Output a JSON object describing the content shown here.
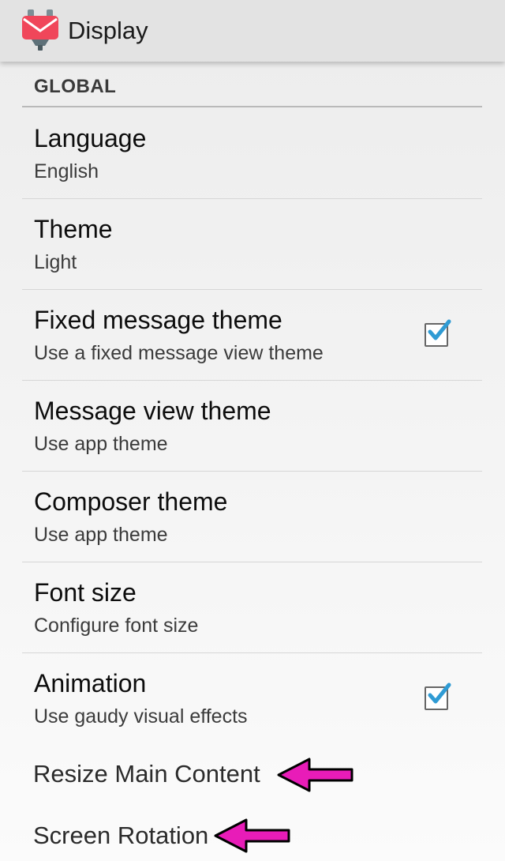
{
  "appbar": {
    "title": "Display",
    "icon": "envelope-pin-icon"
  },
  "section": {
    "header": "GLOBAL"
  },
  "prefs": [
    {
      "title": "Language",
      "summary": "English"
    },
    {
      "title": "Theme",
      "summary": "Light"
    },
    {
      "title": "Fixed message theme",
      "summary": "Use a fixed message view theme",
      "checked": true
    },
    {
      "title": "Message view theme",
      "summary": "Use app theme"
    },
    {
      "title": "Composer theme",
      "summary": "Use app theme"
    },
    {
      "title": "Font size",
      "summary": "Configure font size"
    },
    {
      "title": "Animation",
      "summary": "Use gaudy visual effects",
      "checked": true
    }
  ],
  "extras": [
    {
      "label": "Resize Main Content"
    },
    {
      "label": "Screen Rotation"
    }
  ],
  "colors": {
    "accent": "#2f9bd4",
    "arrow": "#e81cb8",
    "icon": "#f0465a"
  }
}
